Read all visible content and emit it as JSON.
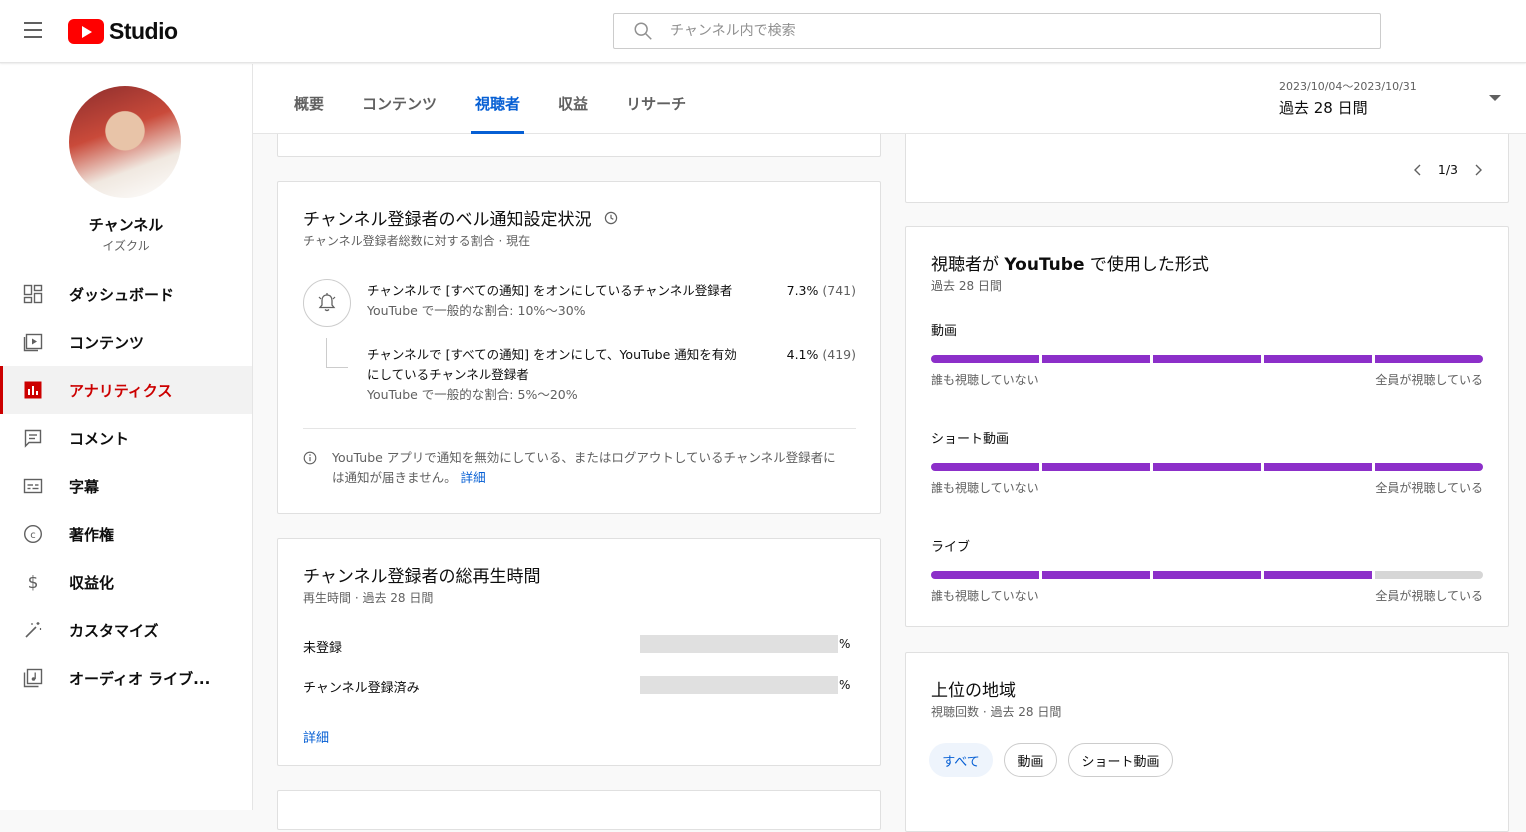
{
  "header": {
    "app_name": "Studio",
    "search_placeholder": "チャンネル内で検索"
  },
  "sidebar": {
    "channel_name": "チャンネル",
    "channel_sub": "イズクル",
    "items": [
      {
        "label": "ダッシュボード",
        "icon": "dashboard-icon"
      },
      {
        "label": "コンテンツ",
        "icon": "content-icon"
      },
      {
        "label": "アナリティクス",
        "icon": "analytics-icon",
        "active": true
      },
      {
        "label": "コメント",
        "icon": "comment-icon"
      },
      {
        "label": "字幕",
        "icon": "subtitles-icon"
      },
      {
        "label": "著作権",
        "icon": "copyright-icon"
      },
      {
        "label": "収益化",
        "icon": "dollar-icon"
      },
      {
        "label": "カスタマイズ",
        "icon": "magic-wand-icon"
      },
      {
        "label": "オーディオ ライブ...",
        "icon": "audio-library-icon"
      }
    ]
  },
  "tabs": [
    {
      "label": "概要"
    },
    {
      "label": "コンテンツ"
    },
    {
      "label": "視聴者",
      "active": true
    },
    {
      "label": "収益"
    },
    {
      "label": "リサーチ"
    }
  ],
  "date_range": {
    "dates": "2023/10/04～2023/10/31",
    "label": "過去 28 日間"
  },
  "pager": {
    "text": "1/3"
  },
  "bell_card": {
    "title": "チャンネル登録者のベル通知設定状況",
    "subtitle": "チャンネル登録者総数に対する割合 · 現在",
    "row1": {
      "text": "チャンネルで [すべての通知] をオンにしているチャンネル登録者",
      "sub": "YouTube で一般的な割合: 10%～30%",
      "percent": "7.3%",
      "count": "(741)"
    },
    "row2": {
      "text_line1": "チャンネルで [すべての通知] をオンにして、YouTube 通知を有効",
      "text_line2": "にしているチャンネル登録者",
      "sub": "YouTube で一般的な割合: 5%～20%",
      "percent": "4.1%",
      "count": "(419)"
    },
    "note_line1": "YouTube アプリで通知を無効にしている、またはログアウトしているチャンネル登録者に",
    "note_line2": "は通知が届きません。",
    "note_link": "詳細"
  },
  "watch_card": {
    "title": "チャンネル登録者の総再生時間",
    "subtitle": "再生時間 · 過去 28 日間",
    "rows": [
      {
        "label": "未登録",
        "unit": "%"
      },
      {
        "label": "チャンネル登録済み",
        "unit": "%"
      }
    ],
    "link": "詳細"
  },
  "formats_card": {
    "title_pre": "視聴者が ",
    "title_bold": "YouTube",
    "title_post": " で使用した形式",
    "subtitle": "過去 28 日間",
    "min_label": "誰も視聴していない",
    "max_label": "全員が視聴している",
    "rows": [
      {
        "label": "動画",
        "level": 5,
        "of": 5
      },
      {
        "label": "ショート動画",
        "level": 5,
        "of": 5
      },
      {
        "label": "ライブ",
        "level": 4,
        "of": 5
      }
    ],
    "colors": {
      "filled": "#8c2fc9",
      "empty": "#d6d6d6"
    }
  },
  "geo_card": {
    "title": "上位の地域",
    "subtitle": "視聴回数 · 過去 28 日間",
    "chips": [
      {
        "label": "すべて",
        "selected": true
      },
      {
        "label": "動画"
      },
      {
        "label": "ショート動画"
      }
    ]
  },
  "colors": {
    "accent": "#065fd4",
    "brand_red": "#ff0000",
    "active_nav": "#cc0000"
  }
}
